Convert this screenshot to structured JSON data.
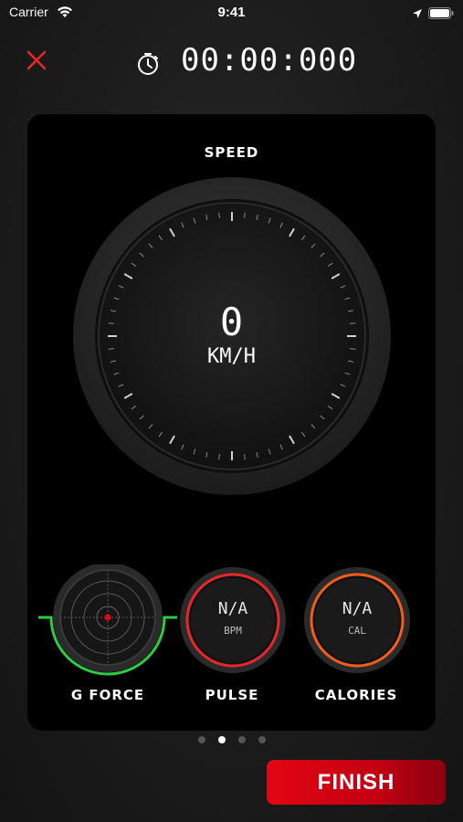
{
  "status_bar": {
    "carrier": "Carrier",
    "time": "9:41",
    "wifi_icon": "wifi-icon",
    "location_icon": "location-arrow-icon",
    "battery_icon": "battery-icon"
  },
  "header": {
    "close_icon": "close-icon",
    "timer_icon": "stopwatch-icon",
    "timer": "00:00:000"
  },
  "speed": {
    "title": "SPEED",
    "value": "0",
    "unit": "KM/H"
  },
  "gauges": {
    "gforce": {
      "label": "G FORCE",
      "accent": "#2ecc40",
      "dot_color": "#e30613"
    },
    "pulse": {
      "label": "PULSE",
      "value": "N/A",
      "unit": "BPM",
      "accent": "#e8262c"
    },
    "calories": {
      "label": "CALORIES",
      "value": "N/A",
      "unit": "CAL",
      "accent": "#f25c1b"
    }
  },
  "pagination": {
    "total": 4,
    "active_index": 1
  },
  "finish_button": {
    "label": "FINISH",
    "color": "#e30613"
  }
}
